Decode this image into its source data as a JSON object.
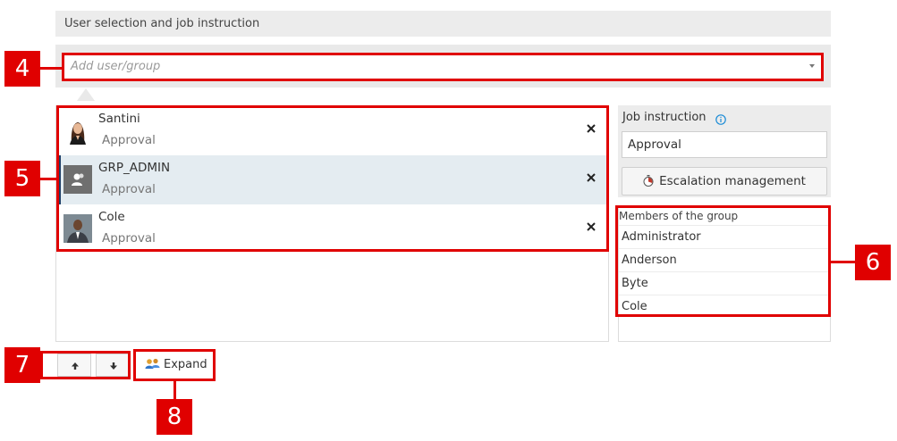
{
  "section": {
    "title": "User selection and job instruction"
  },
  "add_field": {
    "placeholder": "Add user/group"
  },
  "users": [
    {
      "name": "Santini",
      "role": "Approval",
      "avatar": "person-photo-icon"
    },
    {
      "name": "GRP_ADMIN",
      "role": "Approval",
      "avatar": "group-icon"
    },
    {
      "name": "Cole",
      "role": "Approval",
      "avatar": "person-photo-icon"
    }
  ],
  "job_instruction": {
    "label": "Job instruction",
    "value": "Approval",
    "escalation_button": "Escalation management"
  },
  "members": {
    "title": "Members of the group",
    "items": [
      "Administrator",
      "Anderson",
      "Byte",
      "Cole"
    ]
  },
  "toolbar": {
    "expand_label": "Expand"
  },
  "callouts": [
    "4",
    "5",
    "6",
    "7",
    "8"
  ],
  "colors": {
    "callout": "#e00000",
    "selection_bar": "#1f3f67",
    "selected_row": "#e4ecf1",
    "info": "#1a8bd6"
  }
}
